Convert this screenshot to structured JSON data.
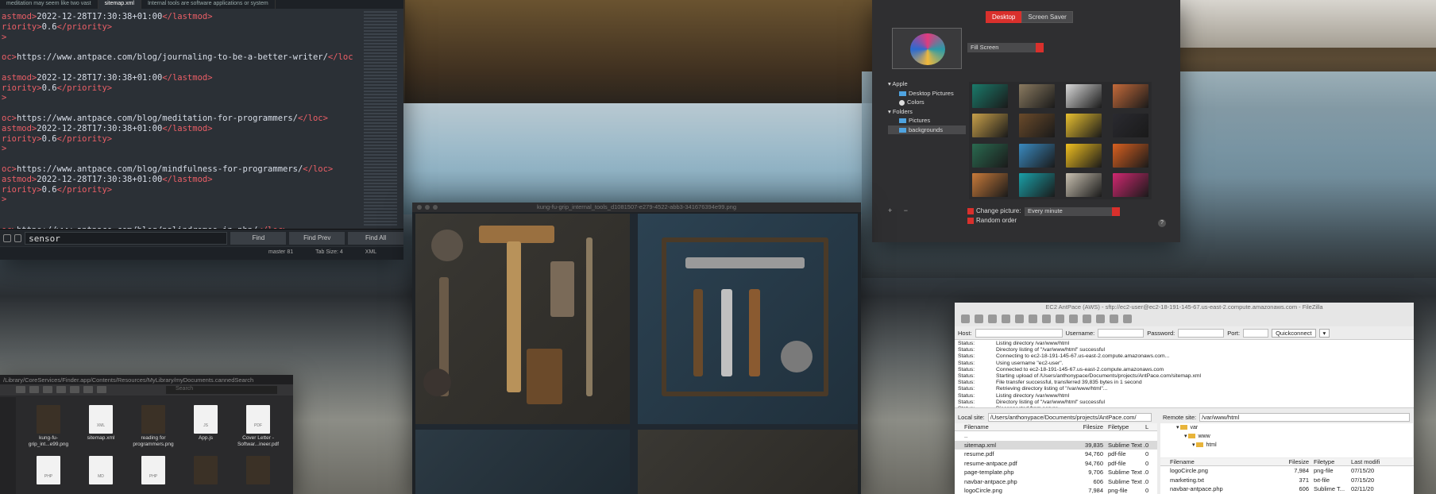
{
  "sublime": {
    "tabs": [
      "meditation may seem like two vast",
      "sitemap.xml",
      "Internal tools are software applications or system"
    ],
    "code_lines": [
      {
        "parts": [
          [
            "tg",
            "astmod>"
          ],
          [
            "tx",
            "2022-12-28T17:30:38+01:00"
          ],
          [
            "tg",
            "</lastmod>"
          ]
        ]
      },
      {
        "parts": [
          [
            "tg",
            "riority>"
          ],
          [
            "tx",
            "0.6"
          ],
          [
            "tg",
            "</priority>"
          ]
        ]
      },
      {
        "parts": [
          [
            "tg",
            ">"
          ]
        ]
      },
      {
        "parts": []
      },
      {
        "parts": [
          [
            "tg",
            "oc>"
          ],
          [
            "tx",
            "https://www.antpace.com/blog/journaling-to-be-a-better-writer/"
          ],
          [
            "tg",
            "</loc"
          ]
        ]
      },
      {
        "parts": []
      },
      {
        "parts": [
          [
            "tg",
            "astmod>"
          ],
          [
            "tx",
            "2022-12-28T17:30:38+01:00"
          ],
          [
            "tg",
            "</lastmod>"
          ]
        ]
      },
      {
        "parts": [
          [
            "tg",
            "riority>"
          ],
          [
            "tx",
            "0.6"
          ],
          [
            "tg",
            "</priority>"
          ]
        ]
      },
      {
        "parts": [
          [
            "tg",
            ">"
          ]
        ]
      },
      {
        "parts": []
      },
      {
        "parts": [
          [
            "tg",
            "oc>"
          ],
          [
            "tx",
            "https://www.antpace.com/blog/meditation-for-programmers/"
          ],
          [
            "tg",
            "</loc>"
          ]
        ]
      },
      {
        "parts": [
          [
            "tg",
            "astmod>"
          ],
          [
            "tx",
            "2022-12-28T17:30:38+01:00"
          ],
          [
            "tg",
            "</lastmod>"
          ]
        ]
      },
      {
        "parts": [
          [
            "tg",
            "riority>"
          ],
          [
            "tx",
            "0.6"
          ],
          [
            "tg",
            "</priority>"
          ]
        ]
      },
      {
        "parts": [
          [
            "tg",
            ">"
          ]
        ]
      },
      {
        "parts": []
      },
      {
        "parts": [
          [
            "tg",
            "oc>"
          ],
          [
            "tx",
            "https://www.antpace.com/blog/mindfulness-for-programmers/"
          ],
          [
            "tg",
            "</loc>"
          ]
        ]
      },
      {
        "parts": [
          [
            "tg",
            "astmod>"
          ],
          [
            "tx",
            "2022-12-28T17:30:38+01:00"
          ],
          [
            "tg",
            "</lastmod>"
          ]
        ]
      },
      {
        "parts": [
          [
            "tg",
            "riority>"
          ],
          [
            "tx",
            "0.6"
          ],
          [
            "tg",
            "</priority>"
          ]
        ]
      },
      {
        "parts": [
          [
            "tg",
            ">"
          ]
        ]
      },
      {
        "parts": []
      },
      {
        "parts": []
      },
      {
        "parts": [
          [
            "tg",
            "oc>"
          ],
          [
            "tx",
            "https://www.antpace.com/blog/palindromes-in-php/"
          ],
          [
            "tg",
            "</loc>"
          ]
        ]
      }
    ],
    "find_value": "sensor",
    "find_btn": "Find",
    "find_prev_btn": "Find Prev",
    "find_all_btn": "Find All",
    "status_branch": "master",
    "status_branch_badge": "81",
    "status_tabsize": "Tab Size: 4",
    "status_syntax": "XML"
  },
  "prefs": {
    "tab_desktop": "Desktop",
    "tab_screensaver": "Screen Saver",
    "fill_mode": "Fill Screen",
    "sources": [
      {
        "label": "Apple",
        "type": "group"
      },
      {
        "label": "Desktop Pictures",
        "type": "folder"
      },
      {
        "label": "Colors",
        "type": "color"
      },
      {
        "label": "Folders",
        "type": "group"
      },
      {
        "label": "Pictures",
        "type": "folder"
      },
      {
        "label": "backgrounds",
        "type": "folder-selected"
      }
    ],
    "thumb_colors": [
      "#1a7a6a",
      "#8a7a60",
      "#d8d8d8",
      "#c46a3a",
      "#c8a04a",
      "#6a4a2a",
      "#e8c030",
      "#2a2a30",
      "#2a6a50",
      "#3a8ac0",
      "#f0c020",
      "#d86020",
      "#c87a3a",
      "#1aa0a8",
      "#c8c0b0",
      "#d02870"
    ],
    "change_picture_label": "Change picture:",
    "change_interval": "Every minute",
    "random_order_label": "Random order",
    "add_remove": "+ −",
    "help": "?"
  },
  "viewer": {
    "title": "kung-fu-grip_internal_tools_d1081507-e279-4522-abb3-341676394e99.png"
  },
  "finder": {
    "path": "/Library/CoreServices/Finder.app/Contents/Resources/MyLibrary/myDocuments.cannedSearch",
    "search_placeholder": "Search",
    "items": [
      {
        "name": "kung-fu-\ngrip_int...e99.png",
        "kind": "img",
        "ext": ""
      },
      {
        "name": "sitemap.xml",
        "kind": "doc",
        "ext": "XML"
      },
      {
        "name": "reading for\nprogrammers.png",
        "kind": "img",
        "ext": ""
      },
      {
        "name": "App.js",
        "kind": "doc",
        "ext": "JS"
      },
      {
        "name": "Cover Letter -\nSoftwar...ineer.pdf",
        "kind": "doc",
        "ext": "PDF"
      },
      {
        "name": "",
        "kind": "empty",
        "ext": ""
      },
      {
        "name": "",
        "kind": "doc",
        "ext": "PHP"
      },
      {
        "name": "",
        "kind": "doc",
        "ext": "MD"
      },
      {
        "name": "",
        "kind": "doc",
        "ext": "PHP"
      },
      {
        "name": "",
        "kind": "img",
        "ext": ""
      },
      {
        "name": "",
        "kind": "img",
        "ext": ""
      }
    ]
  },
  "filezilla": {
    "title": "EC2 AntPace (AWS) - sftp://ec2-user@ec2-18-191-145-67.us-east-2.compute.amazonaws.com - FileZilla",
    "host_label": "Host:",
    "username_label": "Username:",
    "password_label": "Password:",
    "port_label": "Port:",
    "quickconnect": "Quickconnect",
    "log": [
      [
        "Status:",
        "Listing directory /var/www/html"
      ],
      [
        "Status:",
        "Directory listing of \"/var/www/html\" successful"
      ],
      [
        "Status:",
        "Connecting to ec2-18-191-145-67.us-east-2.compute.amazonaws.com..."
      ],
      [
        "Status:",
        "Using username \"ec2-user\"."
      ],
      [
        "Status:",
        "Connected to ec2-18-191-145-67.us-east-2.compute.amazonaws.com"
      ],
      [
        "Status:",
        "Starting upload of /Users/anthonypace/Documents/projects/AntPace.com/sitemap.xml"
      ],
      [
        "Status:",
        "File transfer successful, transferred 39,835 bytes in 1 second"
      ],
      [
        "Status:",
        "Retrieving directory listing of \"/var/www/html\"..."
      ],
      [
        "Status:",
        "Listing directory /var/www/html"
      ],
      [
        "Status:",
        "Directory listing of \"/var/www/html\" successful"
      ],
      [
        "Status:",
        "Disconnected from server"
      ]
    ],
    "local_label": "Local site:",
    "local_path": "/Users/anthonypace/Documents/projects/AntPace.com/",
    "remote_label": "Remote site:",
    "remote_path": "/var/www/html",
    "local_headers": [
      "Filename",
      "Filesize",
      "Filetype",
      "L"
    ],
    "local_rows": [
      [
        "..",
        "",
        "",
        ""
      ],
      [
        "sitemap.xml",
        "39,835",
        "Sublime Text ...",
        "0"
      ],
      [
        "resume.pdf",
        "94,760",
        "pdf-file",
        "0"
      ],
      [
        "resume-antpace.pdf",
        "94,760",
        "pdf-file",
        "0"
      ],
      [
        "page-template.php",
        "9,706",
        "Sublime Text ...",
        "0"
      ],
      [
        "navbar-antpace.php",
        "606",
        "Sublime Text ...",
        "0"
      ],
      [
        "logoCircle.png",
        "7,984",
        "png-file",
        "0"
      ]
    ],
    "tree": [
      "var",
      "www",
      "html"
    ],
    "remote_headers": [
      "Filename",
      "Filesize",
      "Filetype",
      "Last modifi"
    ],
    "remote_rows": [
      [
        "logoCircle.png",
        "7,984",
        "png-file",
        "07/15/20"
      ],
      [
        "marketing.txt",
        "371",
        "txt-file",
        "07/15/20"
      ],
      [
        "navbar-antpace.php",
        "606",
        "Sublime T...",
        "02/11/20"
      ]
    ]
  }
}
